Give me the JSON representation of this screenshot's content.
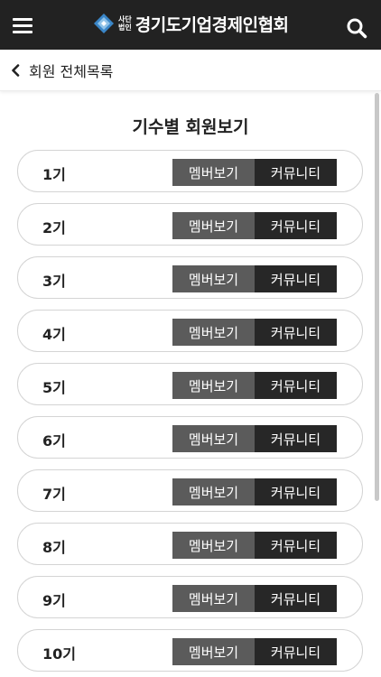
{
  "header": {
    "logo_sub_top": "사단",
    "logo_sub_bottom": "법인",
    "org_name": "경기도기업경제인협회"
  },
  "subnav": {
    "back_label": "회원 전체목록"
  },
  "page": {
    "title": "기수별 회원보기"
  },
  "cohorts": [
    {
      "label": "1기",
      "member_btn": "멤버보기",
      "community_btn": "커뮤니티"
    },
    {
      "label": "2기",
      "member_btn": "멤버보기",
      "community_btn": "커뮤니티"
    },
    {
      "label": "3기",
      "member_btn": "멤버보기",
      "community_btn": "커뮤니티"
    },
    {
      "label": "4기",
      "member_btn": "멤버보기",
      "community_btn": "커뮤니티"
    },
    {
      "label": "5기",
      "member_btn": "멤버보기",
      "community_btn": "커뮤니티"
    },
    {
      "label": "6기",
      "member_btn": "멤버보기",
      "community_btn": "커뮤니티"
    },
    {
      "label": "7기",
      "member_btn": "멤버보기",
      "community_btn": "커뮤니티"
    },
    {
      "label": "8기",
      "member_btn": "멤버보기",
      "community_btn": "커뮤니티"
    },
    {
      "label": "9기",
      "member_btn": "멤버보기",
      "community_btn": "커뮤니티"
    },
    {
      "label": "10기",
      "member_btn": "멤버보기",
      "community_btn": "커뮤니티"
    }
  ],
  "icons": {
    "menu": "hamburger-menu-icon",
    "search": "search-icon",
    "back": "chevron-left-icon",
    "logo": "diamond-logo-icon"
  },
  "colors": {
    "header_bg": "#222222",
    "member_btn_bg": "#5b5b5b",
    "community_btn_bg": "#272727",
    "logo_blue": "#3a86c8",
    "logo_light": "#8fc2e8"
  }
}
